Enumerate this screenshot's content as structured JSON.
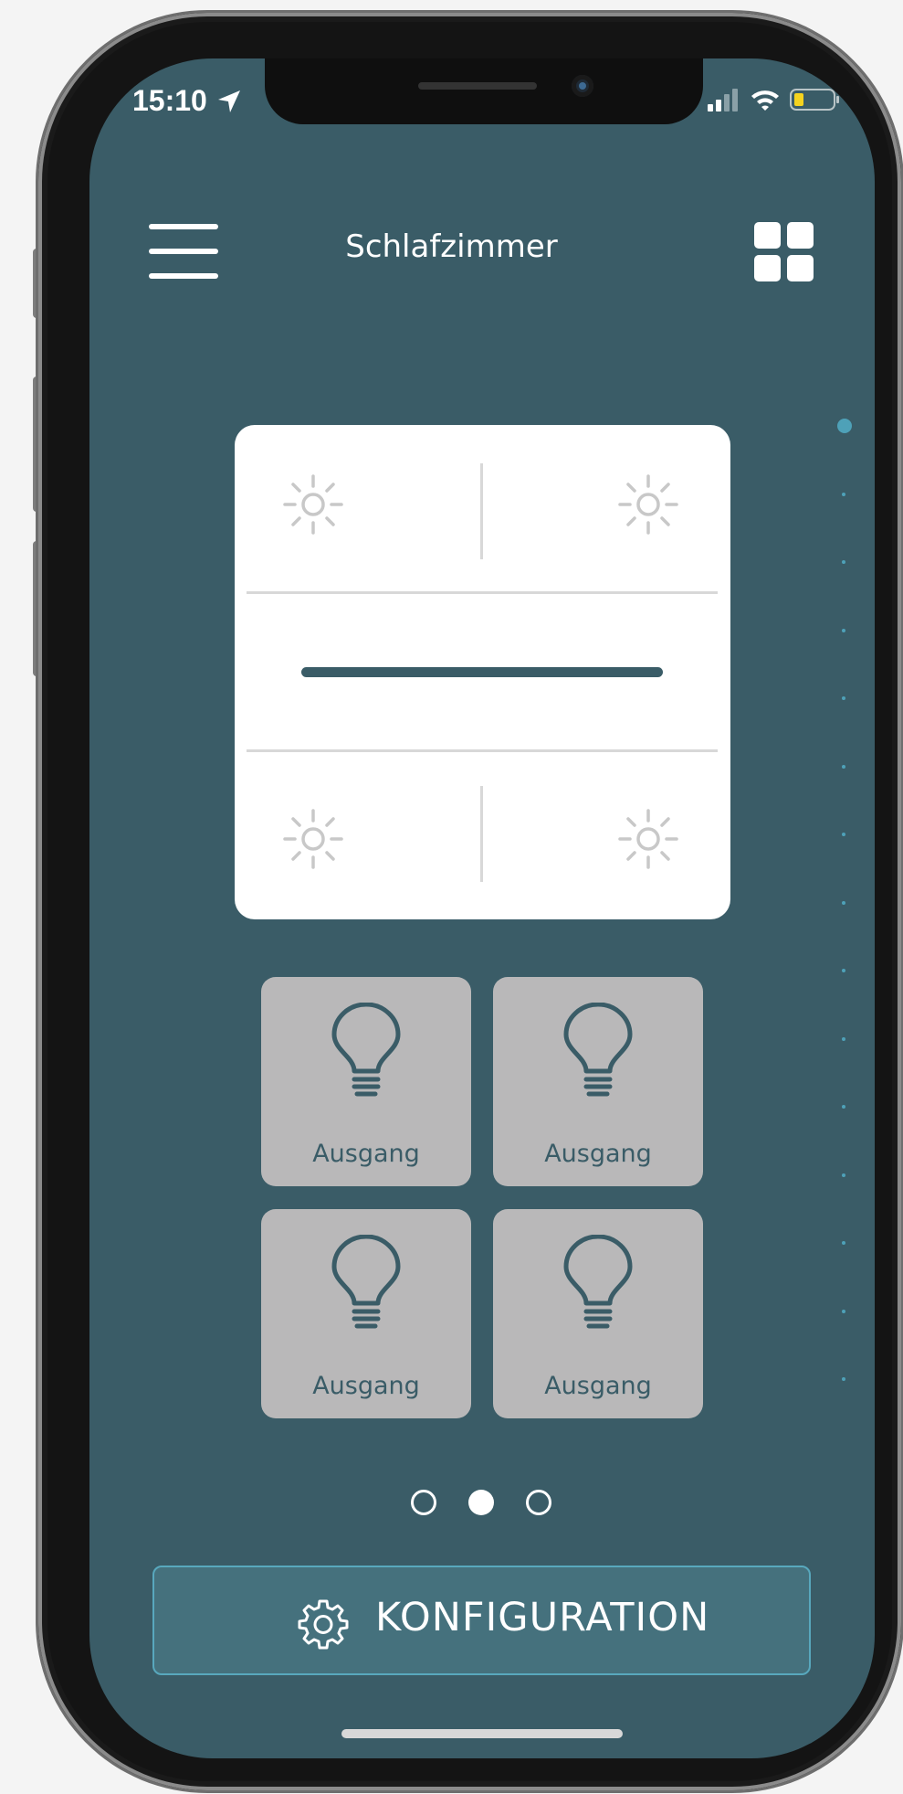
{
  "status_bar": {
    "time": "15:10",
    "location_icon": "location-arrow-icon",
    "signal_icon": "cellular-signal-icon",
    "wifi_icon": "wifi-icon",
    "battery_icon": "battery-low-icon",
    "battery_color": "#f5d31e"
  },
  "header": {
    "menu_icon": "hamburger-menu-icon",
    "title": "Schlafzimmer",
    "grid_icon": "grid-view-icon"
  },
  "switch_panel": {
    "buttons": [
      {
        "position": "top-left",
        "icon": "sun-icon"
      },
      {
        "position": "top-right",
        "icon": "sun-icon"
      },
      {
        "position": "bottom-left",
        "icon": "sun-icon"
      },
      {
        "position": "bottom-right",
        "icon": "sun-icon"
      }
    ],
    "slider_icon": "dimmer-bar"
  },
  "outputs": [
    {
      "label": "Ausgang",
      "icon": "light-bulb-icon"
    },
    {
      "label": "Ausgang",
      "icon": "light-bulb-icon"
    },
    {
      "label": "Ausgang",
      "icon": "light-bulb-icon"
    },
    {
      "label": "Ausgang",
      "icon": "light-bulb-icon"
    }
  ],
  "pagination": {
    "pages": 3,
    "current": 2
  },
  "side_scroll_indicator": {
    "total_dots": 15,
    "active_index": 1
  },
  "config_button": {
    "label": "KONFIGURATION",
    "icon": "gear-icon"
  },
  "colors": {
    "background": "#3a5c67",
    "accent": "#4ea1b8",
    "tile": "#b9b8b9",
    "button": "#45717d"
  }
}
